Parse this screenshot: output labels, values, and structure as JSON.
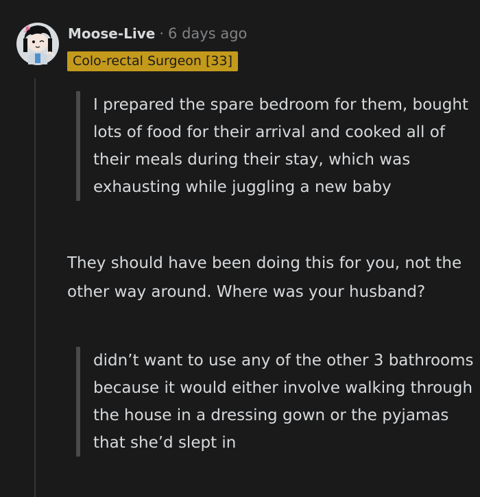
{
  "comment": {
    "username": "Moose-Live",
    "separator": "·",
    "timestamp": "6 days ago",
    "flair": "Colo-rectal Surgeon [33]",
    "quote_1": "I prepared the spare bedroom for them, bought lots of food for their arrival and cooked all of their meals during their stay, which was exhausting while juggling a new baby",
    "body": "They should have been doing this for you, not the other way around. Where was your husband?",
    "quote_2": "didn’t want to use any of the other 3 bathrooms because it would either involve walking through the house in a dressing gown or the pyjamas that she’d slept in"
  },
  "colors": {
    "background": "#1a1a1b",
    "text": "#d7dadc",
    "muted": "#818384",
    "flair_bg": "#c49a1c",
    "quote_bar": "#4a4a4c",
    "thread_line": "#343536"
  }
}
